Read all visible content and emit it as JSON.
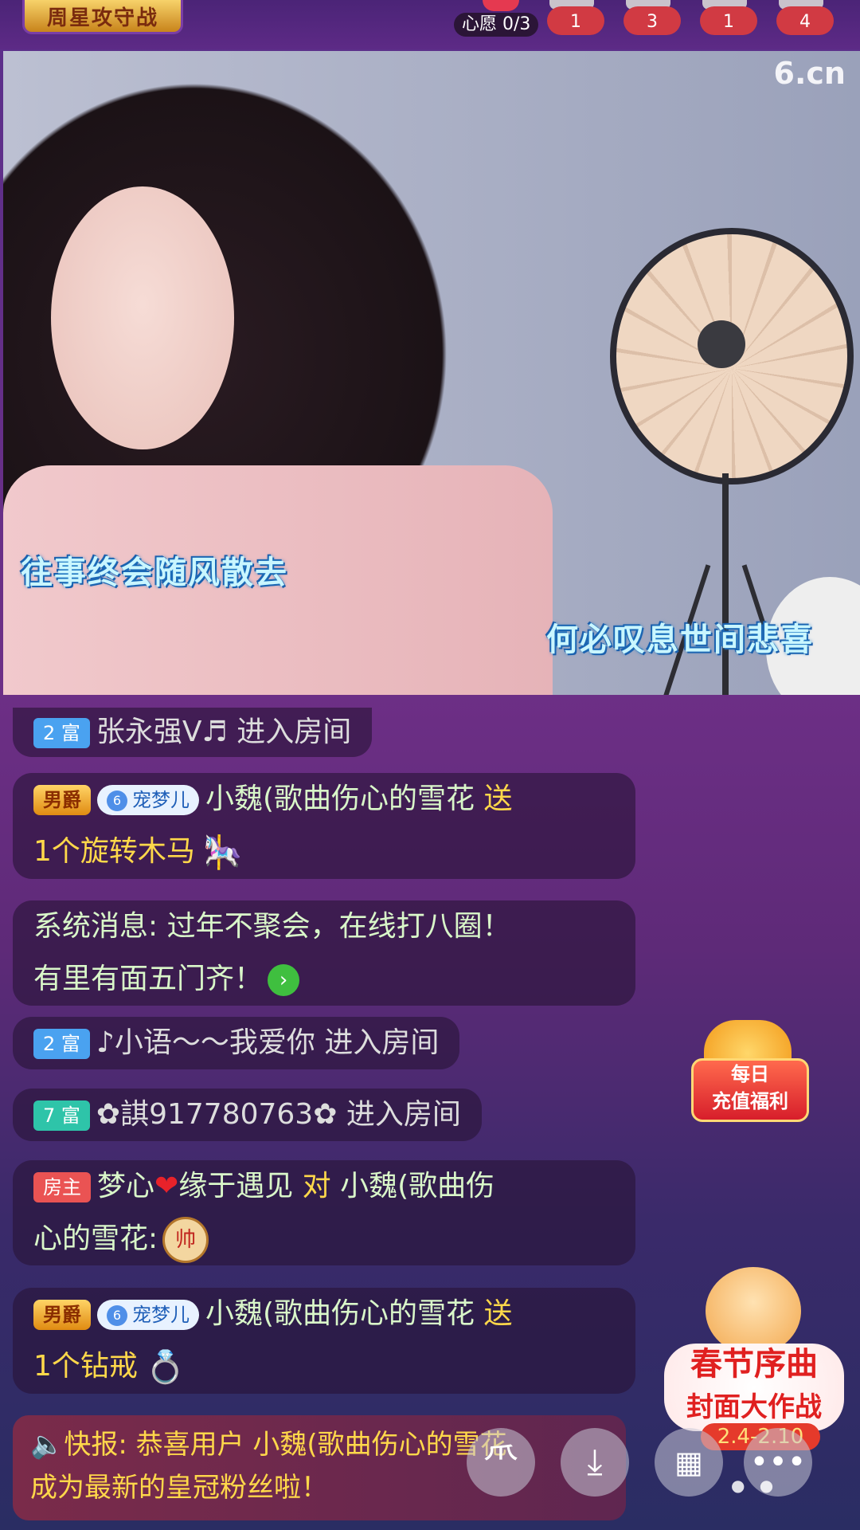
{
  "top": {
    "event_title": "周星攻守战",
    "wish": "心愿 0/3",
    "ranks": [
      "1",
      "3",
      "1",
      "4"
    ]
  },
  "video": {
    "logo": "6.cn",
    "lyric_1": "往事终会随风散去",
    "lyric_2": "何必叹息世间悲喜"
  },
  "chat": {
    "m1": {
      "badge": "2 富",
      "text": "张永强V♬ 进入房间"
    },
    "m2": {
      "noble": "男爵",
      "pet_level": "6",
      "pet": "宠梦儿",
      "user": "小魏(歌曲伤心的雪花",
      "action": "送",
      "gift": "1个旋转木马"
    },
    "m3": {
      "line1": "系统消息: 过年不聚会，在线打八圈！",
      "line2": "有里有面五门齐！"
    },
    "m4": {
      "badge": "2 富",
      "text": "♪小语～～我爱你 进入房间"
    },
    "m5": {
      "badge": "7 富",
      "text": "✿諆917780763✿ 进入房间"
    },
    "m6": {
      "badge": "房主",
      "user": "梦心",
      "heart": "❤",
      "user2": "缘于遇见",
      "action": "对",
      "target_1": "小魏(歌曲伤",
      "target_2": "心的雪花:",
      "chess": "帅"
    },
    "m7": {
      "noble": "男爵",
      "pet_level": "6",
      "pet": "宠梦儿",
      "user": "小魏(歌曲伤心的雪花",
      "action": "送",
      "gift": "1个钻戒"
    },
    "flash": {
      "line1": "快报: 恭喜用户 小魏(歌曲伤心的雪花",
      "line2": "成为最新的皇冠粉丝啦！"
    }
  },
  "promos": {
    "daily_1": "每日",
    "daily_2": "充值福利",
    "spring_1": "春节序曲",
    "spring_2": "封面大作战",
    "spring_date": "2.4-2.10"
  },
  "icons": [
    "six-logo-button-icon",
    "download-icon",
    "grid-menu-icon",
    "more-icon",
    "speaker-icon"
  ]
}
